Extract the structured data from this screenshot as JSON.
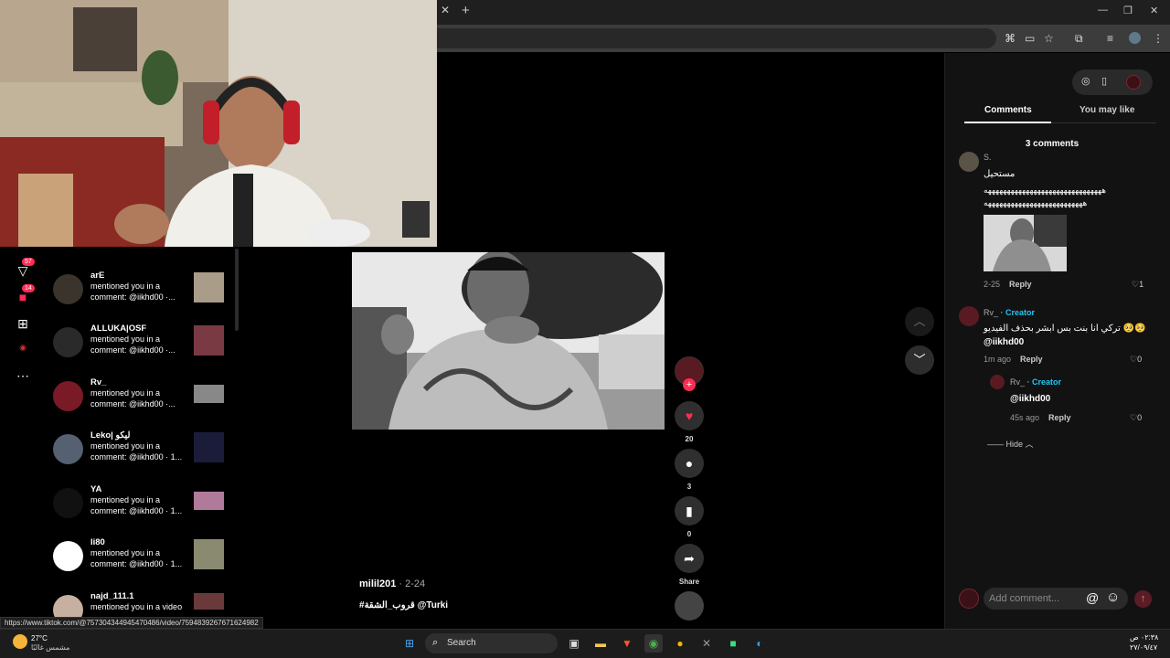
{
  "browser": {
    "toolbar_icons": [
      "translate-icon",
      "cast-icon",
      "star-icon",
      "extensions-icon",
      "media-icon",
      "profile-icon",
      "menu-icon"
    ]
  },
  "sidebar": {
    "badges": {
      "activity": "57",
      "messages": "14"
    },
    "notifications": [
      {
        "name": "arE",
        "message": "mentioned you in a comment: @iikhd00 ·..."
      },
      {
        "name": "ALLUKA|OSF",
        "message": "mentioned you in a comment: @iikhd00 ·..."
      },
      {
        "name": "Rv_",
        "message": "mentioned you in a comment: @iikhd00 ·..."
      },
      {
        "name": "Leko| ليكو",
        "message": "mentioned you in a comment: @iikhd00 · 1..."
      },
      {
        "name": "YA",
        "message": "mentioned you in a comment: @iikhd00 · 1..."
      },
      {
        "name": "li80",
        "message": "mentioned you in a comment: @iikhd00 · 1..."
      },
      {
        "name": "najd_111.1",
        "message": "mentioned you in a video"
      }
    ]
  },
  "video": {
    "author": "milil201",
    "date": " · 2-24",
    "caption": "#قروب_الشقة @Turki",
    "likes": "20",
    "comments": "3",
    "saves": "0",
    "share_label": "Share"
  },
  "comments_panel": {
    "tabs": [
      "Comments",
      "You may like"
    ],
    "count_label": "3 comments",
    "comments": [
      {
        "name": "S.",
        "line1": "مستحيل",
        "line2": "هههههههههههههههههههههههههههههههه",
        "line3": "ههههههههههههههههههههههههههه",
        "meta_time": "2-25",
        "reply": "Reply",
        "likes": "1"
      },
      {
        "name": "Rv_",
        "tag": " · Creator",
        "line1": "تركي انا بنت بس ابشر بحذف الفيديو 🥺🥺",
        "line2": "@iikhd00",
        "meta_time": "1m ago",
        "reply": "Reply",
        "likes": "0"
      },
      {
        "name": "Rv_",
        "tag": " · Creator",
        "line1": "@iikhd00",
        "meta_time": "45s ago",
        "reply": "Reply",
        "likes": "0"
      }
    ],
    "hide_label": "Hide",
    "add_comment_placeholder": "Add comment..."
  },
  "status_url": "https://www.tiktok.com/@757304344945470486/video/7594839267671624982",
  "taskbar": {
    "weather_temp": "27°C",
    "weather_cond": "مشمس غالبًا",
    "search_label": "Search",
    "time": "٠٢:٣٨ ص",
    "date": "٢٧/٠٩/٤٧"
  }
}
